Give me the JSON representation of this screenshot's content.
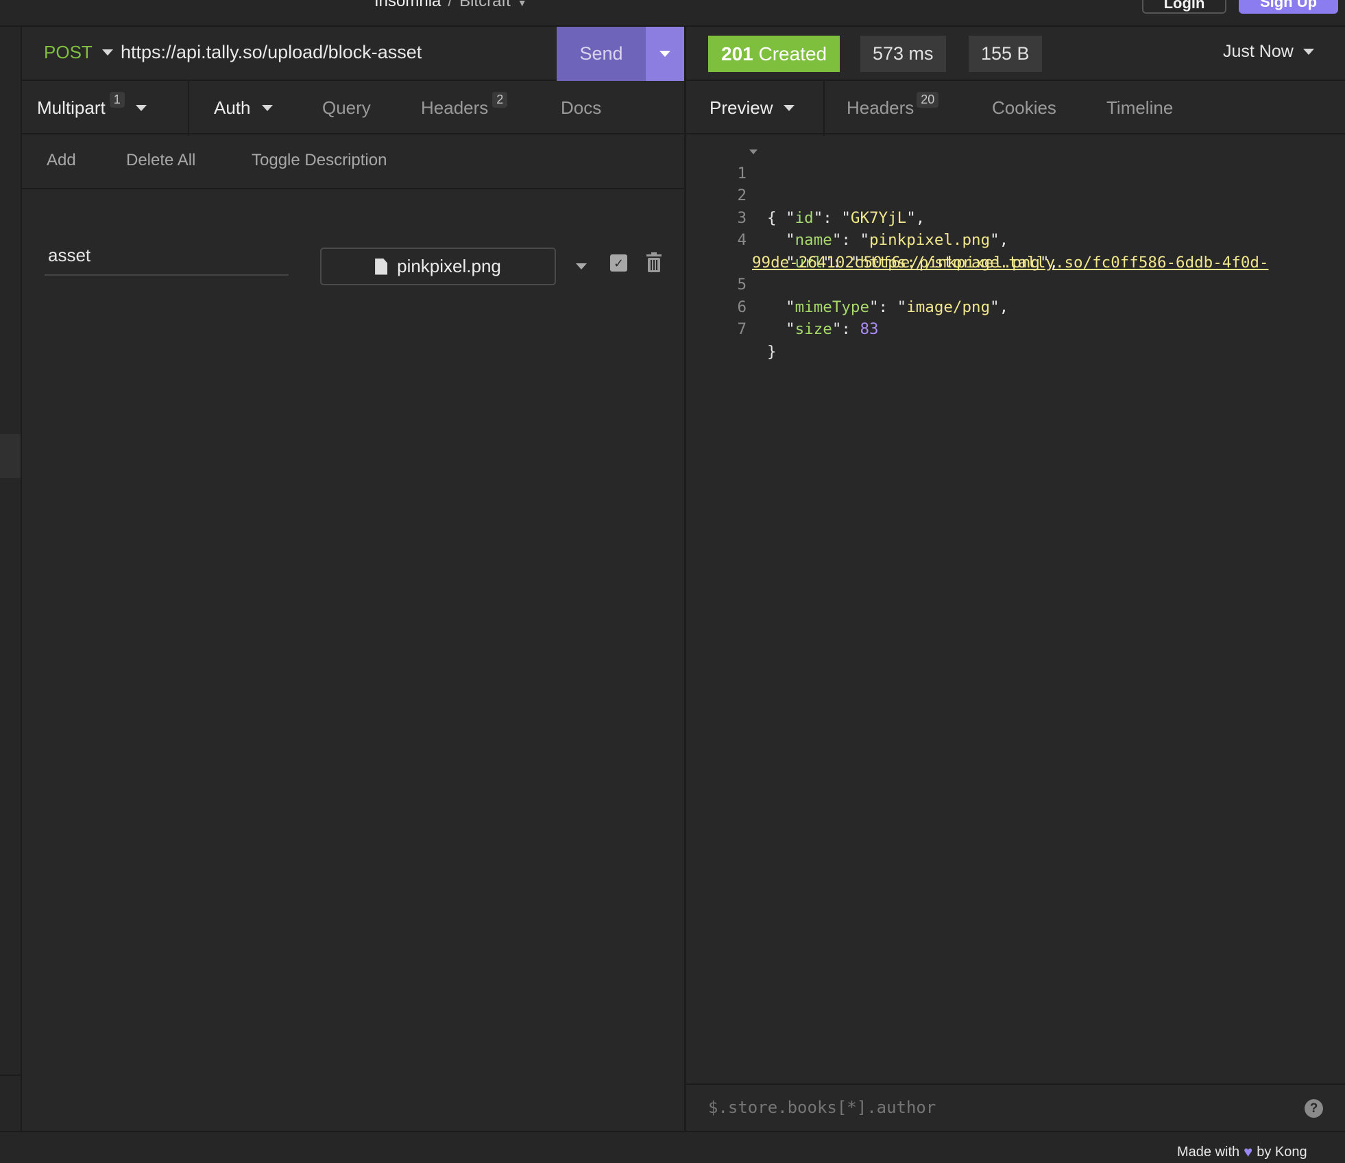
{
  "titlebar": {
    "app_name": "Insomnia",
    "separator": "/",
    "project": "Bitcraft",
    "login_label": "Login",
    "signup_label": "Sign Up"
  },
  "request": {
    "method": "POST",
    "url": "https://api.tally.so/upload/block-asset",
    "send_label": "Send",
    "tabs": [
      {
        "label": "Multipart",
        "badge": "1"
      },
      {
        "label": "Auth"
      },
      {
        "label": "Query"
      },
      {
        "label": "Headers",
        "badge": "2"
      },
      {
        "label": "Docs"
      }
    ],
    "actions": [
      "Add",
      "Delete All",
      "Toggle Description"
    ],
    "params": [
      {
        "name": "asset",
        "file": "pinkpixel.png",
        "enabled": true
      }
    ]
  },
  "response": {
    "status": {
      "code": "201",
      "text": "Created",
      "color": "#7fbf3e"
    },
    "time": "573 ms",
    "size": "155 B",
    "history": "Just Now",
    "tabs": [
      {
        "label": "Preview"
      },
      {
        "label": "Headers",
        "badge": "20"
      },
      {
        "label": "Cookies"
      },
      {
        "label": "Timeline"
      }
    ],
    "body_lines": [
      {
        "n": "1",
        "text": "{"
      },
      {
        "n": "2",
        "key": "id",
        "value": "GK7YjL"
      },
      {
        "n": "3",
        "key": "name",
        "value": "pinkpixel.png"
      },
      {
        "n": "4",
        "key": "url",
        "url_part1": "https://storage.tally.so/fc0ff586-6ddb-4f0d-",
        "url_part2": "99de-264102c50f6e/pinkpixel.png"
      },
      {
        "n": "5",
        "key": "mimeType",
        "value": "image/png"
      },
      {
        "n": "6",
        "key": "size",
        "number": "83"
      },
      {
        "n": "7",
        "text": "}"
      }
    ],
    "filter_placeholder": "$.store.books[*].author",
    "help": "?"
  },
  "statusbar": {
    "made_with": "Made with",
    "by": "by Kong"
  },
  "colors": {
    "accent": "#8b7cf0",
    "send": "#6e64b9",
    "method_post": "#7fbe3e",
    "json_key": "#a6d96a",
    "json_string": "#f0e68c",
    "json_number": "#a98cf0"
  }
}
